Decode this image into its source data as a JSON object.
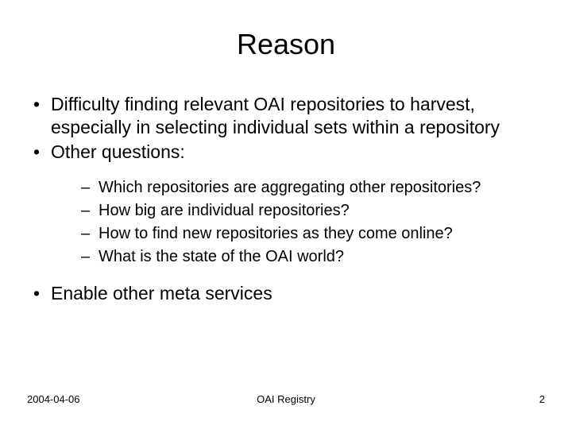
{
  "title": "Reason",
  "bullets": {
    "item1": "Difficulty finding relevant OAI repositories to harvest, especially in selecting individual sets within a repository",
    "item2": "Other questions:",
    "sub1": "Which repositories are aggregating other repositories?",
    "sub2": "How big are individual repositories?",
    "sub3": "How to find new repositories as they come online?",
    "sub4": "What is the state of the OAI world?",
    "item3": "Enable other meta services"
  },
  "footer": {
    "date": "2004-04-06",
    "center": "OAI Registry",
    "page": "2"
  }
}
